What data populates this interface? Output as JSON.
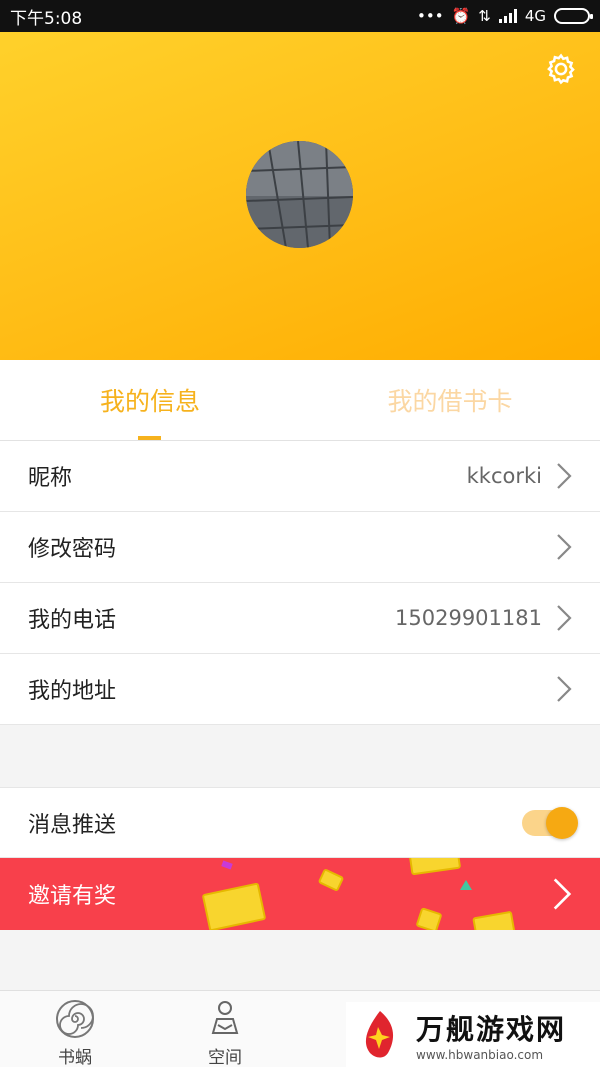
{
  "status_bar": {
    "time": "下午5:08",
    "network": "4G"
  },
  "tabs": [
    {
      "label": "我的信息",
      "active": true
    },
    {
      "label": "我的借书卡",
      "active": false
    }
  ],
  "profile_rows": [
    {
      "label": "昵称",
      "value": "kkcorki"
    },
    {
      "label": "修改密码",
      "value": ""
    },
    {
      "label": "我的电话",
      "value": "15029901181"
    },
    {
      "label": "我的地址",
      "value": ""
    }
  ],
  "notification": {
    "label": "消息推送",
    "enabled": true
  },
  "invite_banner": {
    "label": "邀请有奖"
  },
  "bottom_nav": [
    {
      "label": "书蜗",
      "icon": "snail-icon"
    },
    {
      "label": "空间",
      "icon": "person-reading-icon"
    }
  ],
  "watermark": {
    "main": "万舰游戏网",
    "sub": "www.hbwanbiao.com"
  },
  "colors": {
    "accent": "#f6b21d",
    "banner": "#f8404b",
    "header_top": "#ffd12b",
    "header_bottom": "#ffad00"
  }
}
